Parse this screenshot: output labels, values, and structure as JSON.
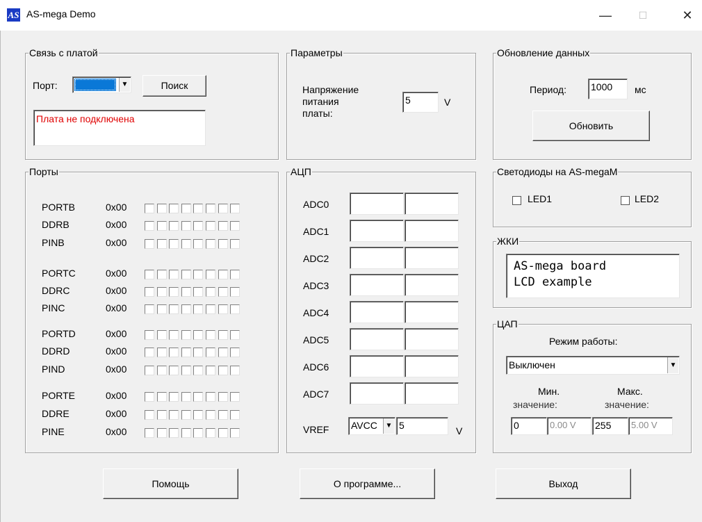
{
  "window": {
    "title": "AS-mega Demo",
    "minimize": "—",
    "maximize": "☐",
    "close": "✕"
  },
  "connection": {
    "legend": "Связь с платой",
    "port_label": "Порт:",
    "search_button": "Поиск",
    "status": "Плата не подключена",
    "status_color": "#e00000"
  },
  "params": {
    "legend": "Параметры",
    "voltage_label_1": "Напряжение",
    "voltage_label_2": "питания",
    "voltage_label_3": "платы:",
    "voltage_value": "5",
    "unit": "V"
  },
  "update": {
    "legend": "Обновление данных",
    "period_label": "Период:",
    "period_value": "1000",
    "unit": "мс",
    "refresh_button": "Обновить"
  },
  "ports": {
    "legend": "Порты",
    "rows": [
      {
        "name": "PORTB",
        "value": "0x00"
      },
      {
        "name": "DDRB",
        "value": "0x00"
      },
      {
        "name": "PINB",
        "value": "0x00"
      },
      {
        "name": "PORTC",
        "value": "0x00"
      },
      {
        "name": "DDRC",
        "value": "0x00"
      },
      {
        "name": "PINC",
        "value": "0x00"
      },
      {
        "name": "PORTD",
        "value": "0x00"
      },
      {
        "name": "DDRD",
        "value": "0x00"
      },
      {
        "name": "PIND",
        "value": "0x00"
      },
      {
        "name": "PORTE",
        "value": "0x00"
      },
      {
        "name": "DDRE",
        "value": "0x00"
      },
      {
        "name": "PINE",
        "value": "0x00"
      }
    ]
  },
  "adc": {
    "legend": "АЦП",
    "channels": [
      "ADC0",
      "ADC1",
      "ADC2",
      "ADC3",
      "ADC4",
      "ADC5",
      "ADC6",
      "ADC7"
    ],
    "vref_label": "VREF",
    "vref_source": "AVCC",
    "vref_value": "5",
    "unit": "V"
  },
  "leds": {
    "legend": "Светодиоды на AS-megaM",
    "led1": "LED1",
    "led2": "LED2"
  },
  "lcd": {
    "legend": "ЖКИ",
    "line1": "AS-mega board",
    "line2": "LCD example"
  },
  "dac": {
    "legend": "ЦАП",
    "mode_label": "Режим работы:",
    "mode_value": "Выключен",
    "min_label_1": "Мин.",
    "min_label_2": "значение:",
    "max_label_1": "Макс.",
    "max_label_2": "значение:",
    "min_value": "0",
    "min_volts": "0.00 V",
    "max_value": "255",
    "max_volts": "5.00 V"
  },
  "footer": {
    "help_button": "Помощь",
    "about_button": "О программе...",
    "exit_button": "Выход"
  },
  "icons": {
    "dropdown": "chevron-down-icon",
    "app": "as-logo-icon"
  }
}
